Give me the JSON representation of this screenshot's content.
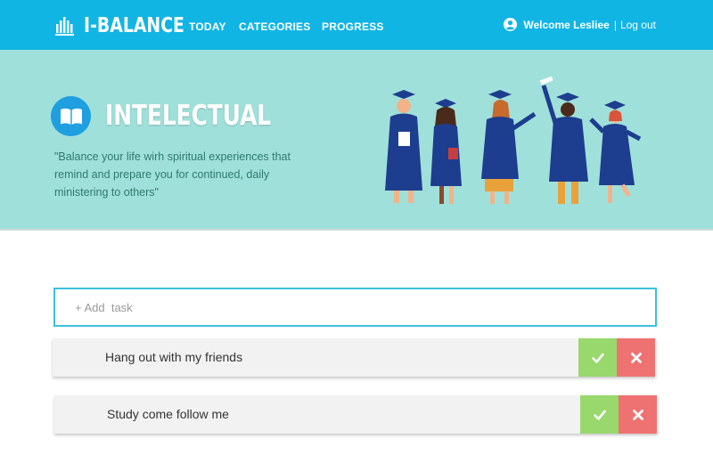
{
  "nav": {
    "brand": "I-BALANCE",
    "links": [
      "TODAY",
      "CATEGORIES",
      "PROGRESS"
    ],
    "welcome": "Welcome Lesliee",
    "separator": "|",
    "logout": "Log out"
  },
  "hero": {
    "title": "INTELECTUAL",
    "quote": "\"Balance your life wirh spiritual experiences that remind and prepare you for continued, daily ministering to others\"",
    "icon": "open-book-icon"
  },
  "add_task": {
    "placeholder": "+ Add  task"
  },
  "tasks": [
    {
      "label": "Hang out with my friends"
    },
    {
      "label": "Study come follow me"
    }
  ],
  "colors": {
    "navbar": "#11b5e4",
    "hero_bg": "#a0e0da",
    "check_green": "#99d86c",
    "delete_red": "#ef7272",
    "gown_blue": "#1d3d8f"
  }
}
